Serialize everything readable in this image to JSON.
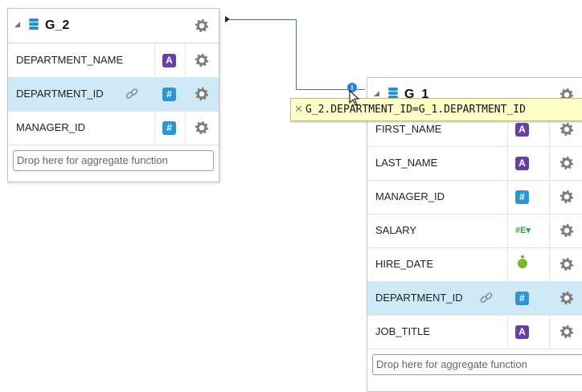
{
  "groups": {
    "g2": {
      "title": "G_2",
      "columns": [
        {
          "name": "DEPARTMENT_NAME",
          "type": "A"
        },
        {
          "name": "DEPARTMENT_ID",
          "type": "#"
        },
        {
          "name": "MANAGER_ID",
          "type": "#"
        }
      ],
      "drop_placeholder": "Drop here for aggregate function"
    },
    "g1": {
      "title": "G_1",
      "columns": [
        {
          "name": "FIRST_NAME",
          "type": "A"
        },
        {
          "name": "LAST_NAME",
          "type": "A"
        },
        {
          "name": "MANAGER_ID",
          "type": "#"
        },
        {
          "name": "SALARY",
          "type": "#E▾"
        },
        {
          "name": "HIRE_DATE",
          "type": "date"
        },
        {
          "name": "DEPARTMENT_ID",
          "type": "#"
        },
        {
          "name": "JOB_TITLE",
          "type": "A"
        }
      ],
      "drop_placeholder": "Drop here for aggregate function"
    }
  },
  "link_tooltip": "G_2.DEPARTMENT_ID=G_1.DEPARTMENT_ID",
  "info_badge": "i",
  "colors": {
    "selected_row": "#cfe9f7",
    "text_type": "#6a3fa5",
    "number_type": "#2a96d6",
    "connector": "#4a6fa5",
    "tooltip_bg": "#ffffc8"
  }
}
